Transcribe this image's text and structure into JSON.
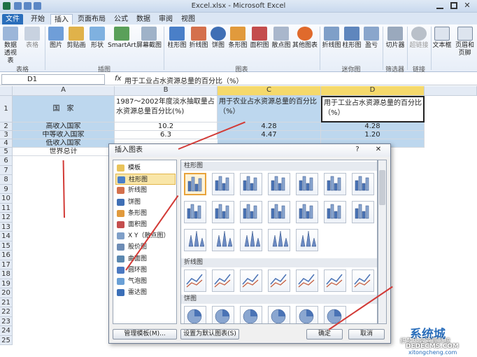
{
  "window": {
    "title": "Excel.xlsx - Microsoft Excel"
  },
  "tabs": [
    "文件",
    "开始",
    "插入",
    "页面布局",
    "公式",
    "数据",
    "审阅",
    "视图"
  ],
  "ribbon": {
    "buttons": [
      "数据透视表",
      "表格",
      "图片",
      "剪贴画",
      "形状",
      "SmartArt",
      "屏幕截图",
      "柱形图",
      "折线图",
      "饼图",
      "条形图",
      "面积图",
      "散点图",
      "其他图表",
      "折线图",
      "柱形图",
      "盈亏",
      "切片器",
      "超链接",
      "文本框",
      "页眉和页脚"
    ],
    "groups": [
      "表格",
      "插图",
      "图表",
      "迷你图",
      "筛选器",
      "链接"
    ]
  },
  "formula_bar": {
    "name_box": "D1",
    "fx": "fx",
    "content": "用于工业占水资源总量的百分比（%）"
  },
  "sheet": {
    "columns": [
      "A",
      "B",
      "C",
      "D"
    ],
    "rows": [
      "1",
      "2",
      "3",
      "4",
      "5",
      "6",
      "7",
      "8",
      "9",
      "10",
      "11",
      "12",
      "13",
      "14",
      "15",
      "16",
      "17",
      "18",
      "19",
      "20",
      "21",
      "22",
      "23",
      "24",
      "25"
    ],
    "header_cells": [
      "国　家",
      "1987～2002年度淡水抽取量占水资源总量百分比(%)",
      "用于农业占水资源总量的百分比（%）",
      "用于工业占水资源总量的百分比（%）"
    ],
    "data": [
      [
        "高收入国家",
        "10.2",
        "4.28",
        "4.28"
      ],
      [
        "中等收入国家",
        "6.3",
        "4.47",
        "1.20"
      ],
      [
        "低收入国家",
        "",
        "",
        ""
      ],
      [
        "世界总计",
        "",
        "",
        ""
      ]
    ]
  },
  "dialog": {
    "title": "插入图表",
    "help": "?",
    "close": "✕",
    "categories": [
      "模板",
      "柱形图",
      "折线图",
      "饼图",
      "条形图",
      "面积图",
      "X Y（散点图）",
      "股价图",
      "曲面图",
      "圆环图",
      "气泡图",
      "雷达图"
    ],
    "sections": [
      "柱形图",
      "折线图",
      "饼图"
    ],
    "manage_button": "管理模板(M)...",
    "default_button": "设置为默认图表(S)",
    "ok_button": "确定",
    "cancel_button": "取消"
  },
  "watermark": {
    "brand": "系统城",
    "line1": "织梦内容管理系统",
    "line2": "DEDECMS.COM",
    "line3": "xitongcheng.com"
  },
  "colors": {
    "accent": "#2a6ebb",
    "selection": "#bdd7ee",
    "arrow": "#d23a36"
  }
}
